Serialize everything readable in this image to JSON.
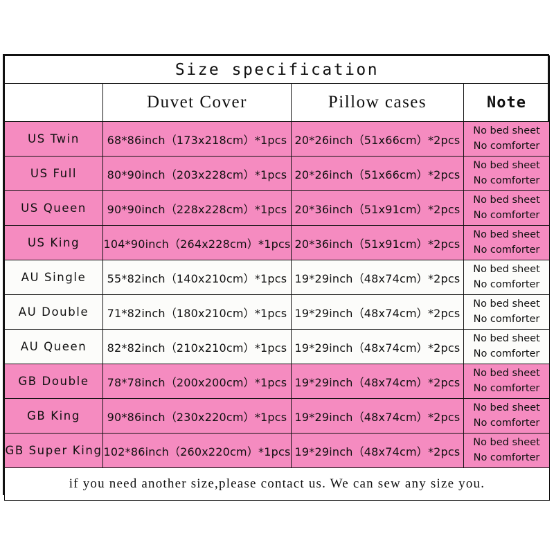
{
  "title": "Size specification",
  "columns": {
    "label": "",
    "duvet": "Duvet Cover",
    "pillow": "Pillow cases",
    "note": "Note"
  },
  "note_lines": {
    "line1": "No bed sheet",
    "line2": "No comforter"
  },
  "colors": {
    "pink": "#F58BC0",
    "white": "#FCFCFA",
    "border": "#111111"
  },
  "rows": [
    {
      "label": "US Twin",
      "duvet": "68*86inch（173x218cm）*1pcs",
      "pillow": "20*26inch（51x66cm）*2pcs",
      "note1": "No bed sheet",
      "note2": "No comforter",
      "highlight": "pink"
    },
    {
      "label": "US Full",
      "duvet": "80*90inch（203x228cm）*1pcs",
      "pillow": "20*26inch（51x66cm）*2pcs",
      "note1": "No bed sheet",
      "note2": "No comforter",
      "highlight": "pink"
    },
    {
      "label": "US Queen",
      "duvet": "90*90inch（228x228cm）*1pcs",
      "pillow": "20*36inch（51x91cm）*2pcs",
      "note1": "No bed sheet",
      "note2": "No comforter",
      "highlight": "pink"
    },
    {
      "label": "US King",
      "duvet": "104*90inch（264x228cm）*1pcs",
      "pillow": "20*36inch（51x91cm）*2pcs",
      "note1": "No bed sheet",
      "note2": "No comforter",
      "highlight": "pink"
    },
    {
      "label": "AU Single",
      "duvet": "55*82inch（140x210cm）*1pcs",
      "pillow": "19*29inch（48x74cm）*2pcs",
      "note1": "No bed sheet",
      "note2": "No comforter",
      "highlight": "white"
    },
    {
      "label": "AU Double",
      "duvet": "71*82inch（180x210cm）*1pcs",
      "pillow": "19*29inch（48x74cm）*2pcs",
      "note1": "No bed sheet",
      "note2": "No comforter",
      "highlight": "white"
    },
    {
      "label": "AU Queen",
      "duvet": "82*82inch（210x210cm）*1pcs",
      "pillow": "19*29inch（48x74cm）*2pcs",
      "note1": "No bed sheet",
      "note2": "No comforter",
      "highlight": "white"
    },
    {
      "label": "GB Double",
      "duvet": "78*78inch（200x200cm）*1pcs",
      "pillow": "19*29inch（48x74cm）*2pcs",
      "note1": "No bed sheet",
      "note2": "No comforter",
      "highlight": "pink"
    },
    {
      "label": "GB King",
      "duvet": "90*86inch（230x220cm）*1pcs",
      "pillow": "19*29inch（48x74cm）*2pcs",
      "note1": "No bed sheet",
      "note2": "No comforter",
      "highlight": "pink"
    },
    {
      "label": "GB Super King",
      "duvet": "102*86inch（260x220cm）*1pcs",
      "pillow": "19*29inch（48x74cm）*2pcs",
      "note1": "No bed sheet",
      "note2": "No comforter",
      "highlight": "pink"
    }
  ],
  "footer": "if you need another size,please contact us. We can sew any size you."
}
